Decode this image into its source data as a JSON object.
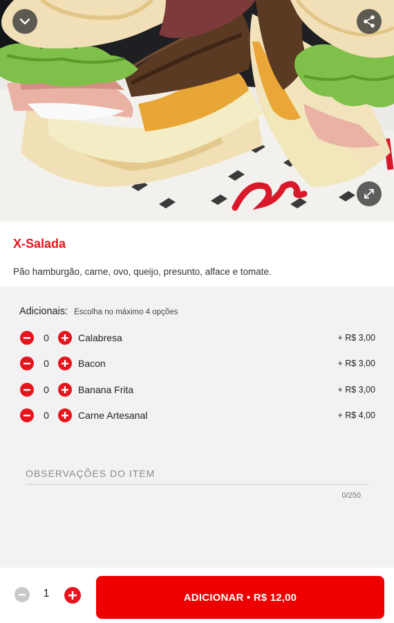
{
  "product": {
    "title": "X-Salada",
    "description": "Pão hamburgão, carne, ovo, queijo, presunto, alface e tomate."
  },
  "hero": {
    "image_alt": "sandwich-photo",
    "icons": [
      "chevron-down-icon",
      "share-icon",
      "expand-icon"
    ]
  },
  "additionals": {
    "title": "Adicionais:",
    "hint": "Escolha no máximo 4 opções",
    "options": [
      {
        "qty": "0",
        "name": "Calabresa",
        "price": "+ R$ 3,00"
      },
      {
        "qty": "0",
        "name": "Bacon",
        "price": "+ R$ 3,00"
      },
      {
        "qty": "0",
        "name": "Banana Frita",
        "price": "+ R$ 3,00"
      },
      {
        "qty": "0",
        "name": "Carne Artesanal",
        "price": "+ R$ 4,00"
      }
    ]
  },
  "observations": {
    "label": "OBSERVAÇÕES DO ITEM",
    "counter": "0/250"
  },
  "footer": {
    "quantity": "1",
    "add_label": "ADICIONAR • R$ 12,00"
  },
  "colors": {
    "accent": "#e8141c",
    "button": "#ee0000",
    "panel_bg": "#f2f2f2"
  }
}
